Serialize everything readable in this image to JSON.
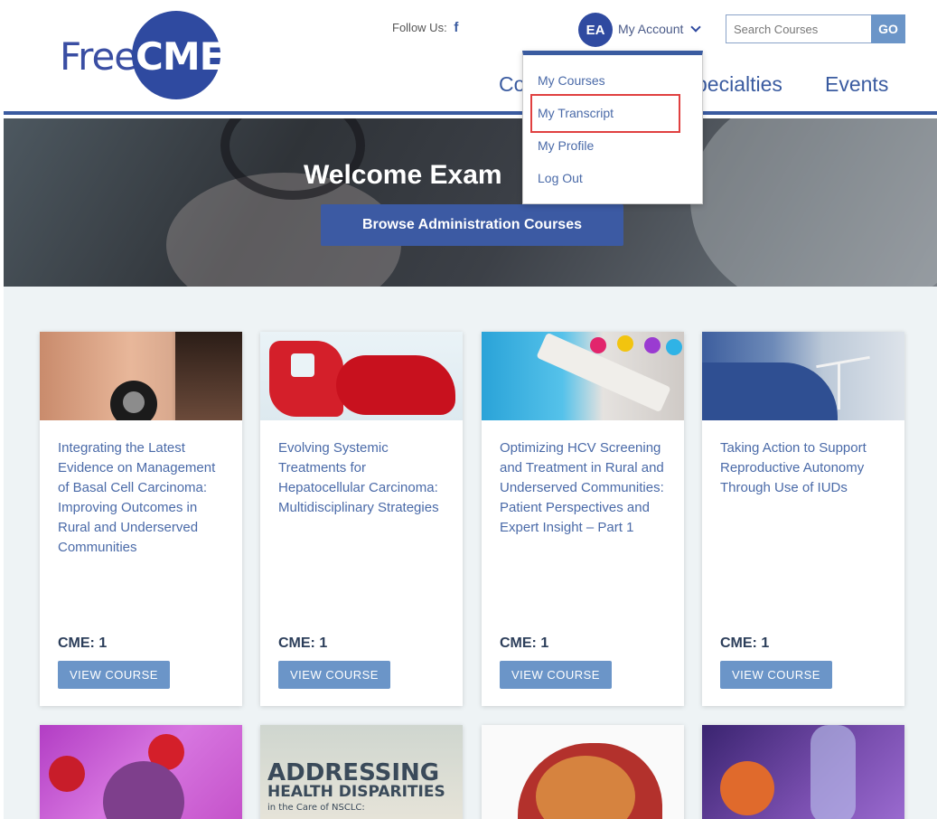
{
  "header": {
    "logo_left": "Free",
    "logo_right": "CME",
    "follow_label": "Follow Us:",
    "facebook_icon": "f",
    "avatar_initials": "EA",
    "account_label": "My Account",
    "search_placeholder": "Search Courses",
    "go_label": "GO",
    "nav": [
      "Co",
      "pecialties",
      "Events"
    ]
  },
  "dropdown": {
    "items": [
      "My Courses",
      "My Transcript",
      "My Profile",
      "Log Out"
    ],
    "highlighted": "My Transcript"
  },
  "hero": {
    "welcome": "Welcome Exam",
    "browse_button": "Browse Administration Courses"
  },
  "courses": [
    {
      "title": "Integrating the Latest Evidence on Management of Basal Cell Carcinoma: Improving Outcomes in Rural and Underserved Communities",
      "cme": "CME: 1",
      "button": "VIEW COURSE"
    },
    {
      "title": "Evolving Systemic Treatments for Hepatocellular Carcinoma: Multidisciplinary Strategies",
      "cme": "CME: 1",
      "button": "VIEW COURSE"
    },
    {
      "title": "Optimizing HCV Screening and Treatment in Rural and Underserved Communities: Patient Perspectives and Expert Insight – Part 1",
      "cme": "CME: 1",
      "button": "VIEW COURSE"
    },
    {
      "title": "Taking Action to Support Reproductive Autonomy Through Use of IUDs",
      "cme": "CME: 1",
      "button": "VIEW COURSE"
    }
  ],
  "second_row": {
    "card2_line1": "ADDRESSING",
    "card2_line2": "HEALTH DISPARITIES",
    "card2_line3": "in the Care of NSCLC:"
  }
}
